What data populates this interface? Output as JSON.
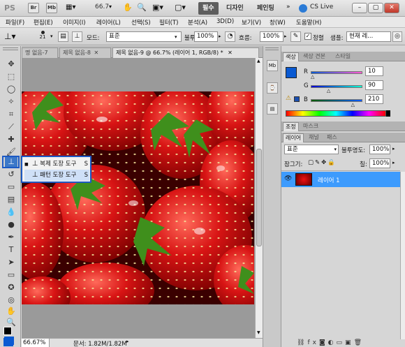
{
  "app": {
    "logo": "PS",
    "bridge_label": "Br",
    "minibridge_label": "Mb",
    "zoom_value": "66.7",
    "workspace_buttons": [
      "필수",
      "디자인",
      "페인팅"
    ],
    "cs_live": "CS Live"
  },
  "menu": [
    "파일(F)",
    "편집(E)",
    "이미지(I)",
    "레이어(L)",
    "선택(S)",
    "필터(T)",
    "분석(A)",
    "3D(D)",
    "보기(V)",
    "창(W)",
    "도움말(H)"
  ],
  "options": {
    "brush_size": "21",
    "mode_label": "모드:",
    "mode_value": "표준",
    "opacity_label": "불투명도:",
    "opacity_value": "100%",
    "flow_label": "흐름:",
    "flow_value": "100%",
    "aligned_label": "정렬",
    "sample_label": "샘플:",
    "sample_value": "현재 레..."
  },
  "tabs": [
    {
      "label": "명 없음-7"
    },
    {
      "label": "제목 없음-8"
    },
    {
      "label": "제목 없음-9 @ 66.7% (레이어 1, RGB/8) *"
    }
  ],
  "flyout": {
    "items": [
      {
        "bullet": "■",
        "label": "복제 도장 도구",
        "shortcut": "S"
      },
      {
        "bullet": "",
        "label": "패턴 도장 도구",
        "shortcut": "S"
      }
    ]
  },
  "status": {
    "zoom": "66.67%",
    "doc_info": "문서: 1.82M/1.82M"
  },
  "color_panel": {
    "tabs": [
      "색상",
      "색상 견본",
      "스타일"
    ],
    "r_label": "R",
    "g_label": "G",
    "b_label": "B",
    "r_value": "10",
    "g_value": "90",
    "b_value": "210",
    "r_fraction": 0.04,
    "g_fraction": 0.35,
    "b_fraction": 0.82,
    "foreground_color": "#0a5ad2",
    "background_color": "#1a4fb0"
  },
  "adjust_panel": {
    "tabs": [
      "조정",
      "마스크"
    ]
  },
  "layers_panel": {
    "tabs": [
      "레이어",
      "채널",
      "패스"
    ],
    "blend_mode": "표준",
    "opacity_label": "불투명도:",
    "opacity_value": "100%",
    "lock_label": "잠그기:",
    "fill_label": "칠:",
    "fill_value": "100%",
    "layers": [
      {
        "name": "레이어 1",
        "visible": true,
        "selected": true
      }
    ]
  },
  "colors": {
    "selection_blue": "#3d9bfd",
    "highlight_border": "#1b59c4",
    "active_workspace": "#5e5e5e"
  }
}
